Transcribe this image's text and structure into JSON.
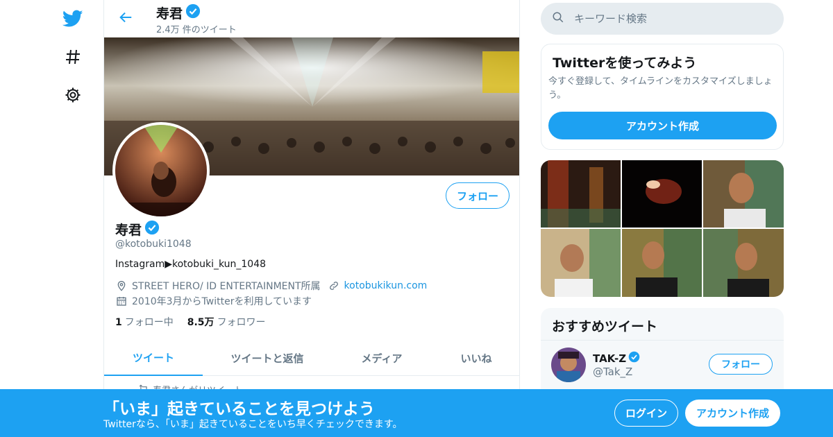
{
  "colors": {
    "accent": "#1da1f2",
    "text": "#14171a",
    "muted": "#657786",
    "border": "#e6ecf0"
  },
  "nav": {
    "icons": [
      "twitter-bird-icon",
      "hashtag-icon",
      "gear-icon"
    ]
  },
  "header": {
    "name": "寿君",
    "tweet_count": "2.4万 件のツイート"
  },
  "profile": {
    "name": "寿君",
    "handle": "@kotobuki1048",
    "bio": "Instagram▶kotobuki_kun_1048",
    "location": "STREET HERO/ ID ENTERTAINMENT所属",
    "website": "kotobukikun.com",
    "joined": "2010年3月からTwitterを利用しています",
    "following_count": "1",
    "following_label": "フォロー中",
    "followers_count": "8.5万",
    "followers_label": "フォロワー",
    "follow_button": "フォロー"
  },
  "tabs": [
    "ツイート",
    "ツイートと返信",
    "メディア",
    "いいね"
  ],
  "retweet_hint": "寿君さんがリツイート",
  "search": {
    "placeholder": "キーワード検索"
  },
  "signup_card": {
    "title": "Twitterを使ってみよう",
    "description": "今すぐ登録して、タイムラインをカスタマイズしましょう。",
    "button": "アカウント作成"
  },
  "recommended": {
    "title": "おすすめツイート",
    "items": [
      {
        "name": "TAK-Z",
        "handle": "@Tak_Z",
        "follow": "フォロー"
      }
    ]
  },
  "bottom_bar": {
    "title": "「いま」起きていることを見つけよう",
    "subtitle": "Twitterなら、「いま」起きていることをいち早くチェックできます。",
    "login": "ログイン",
    "signup": "アカウント作成"
  }
}
